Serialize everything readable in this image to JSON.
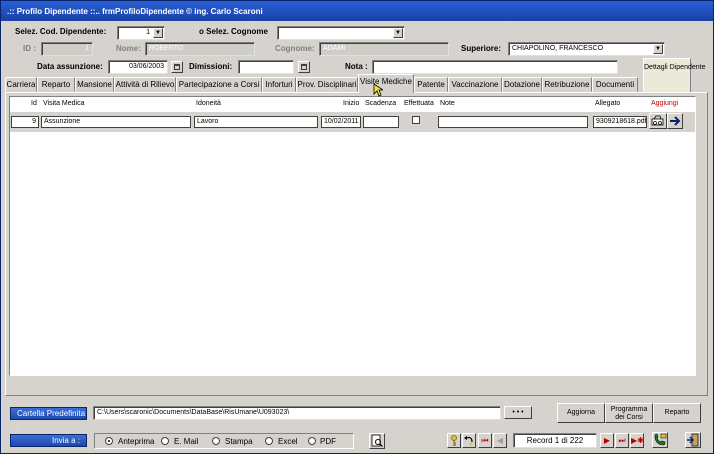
{
  "window": {
    "title": ".:: Profilo Dipendente ::..      frmProfiloDipendente © ing. Carlo Scaroni"
  },
  "header": {
    "sel_cod_label": "Selez. Cod. Dipendente:",
    "sel_cod_value": "1",
    "sel_cognome_label": "o Selez. Cognome",
    "sel_cognome_value": "",
    "id_label": "ID :",
    "id_value": "1",
    "nome_label": "Nome:",
    "nome_value": "ROBERTO",
    "cognome_label": "Cognome:",
    "cognome_value": "ADAMI",
    "superiore_label": "Superiore:",
    "superiore_value": "CHIAPOLINO, FRANCESCO",
    "data_assunzione_label": "Data assunzione:",
    "data_assunzione_value": "03/06/2003",
    "dimissioni_label": "Dimissioni:",
    "dimissioni_value": "",
    "nota_label": "Nota :",
    "nota_value": "",
    "dettagli_label": "Dettagli Dipendente"
  },
  "tabs": [
    {
      "label": "Carriera"
    },
    {
      "label": "Reparto"
    },
    {
      "label": "Mansione"
    },
    {
      "label": "Attività di Rilievo"
    },
    {
      "label": "Partecipazione a Corsi"
    },
    {
      "label": "Inforturi"
    },
    {
      "label": "Prov. Disciplinari"
    },
    {
      "label": "Visite Mediche"
    },
    {
      "label": "Patente"
    },
    {
      "label": "Vaccinazione"
    },
    {
      "label": "Dotazione"
    },
    {
      "label": "Retribuzione"
    },
    {
      "label": "Documenti"
    }
  ],
  "active_tab": "Visite Mediche",
  "grid": {
    "headers": {
      "id": "Id",
      "visita": "Visita Medica",
      "idoneita": "Idoneità",
      "inizio": "Inizio",
      "scadenza": "Scadenza",
      "effettuata": "Effettuata",
      "note": "Note",
      "allegato": "Allegato",
      "aggiungi": "Aggiungi"
    },
    "rows": [
      {
        "id": "9",
        "visita": "Assunzione",
        "idoneita": "Lavoro",
        "inizio": "10/02/2011",
        "scadenza": "",
        "effettuata": false,
        "note": "",
        "allegato": "9309218618.pdf"
      }
    ]
  },
  "footer": {
    "cartella_label": "Cartella Predefinita :",
    "cartella_value": "C:\\Users\\scaronic\\Documents\\DataBase\\RisUmane\\U093023\\",
    "browse_label": "• • •",
    "aggiorna_label": "Aggiorna",
    "programma_label": "Programma dei Corsi",
    "reparto_label": "Reparto",
    "invia_label": "Invia a :",
    "options": [
      "Anteprima",
      "E. Mail",
      "Stampa",
      "Excel",
      "PDF"
    ],
    "selected_option": "Anteprima",
    "record_label": "Record 1 di 222"
  },
  "colors": {
    "title_bar": "#1941a5",
    "accent_red": "#c00000",
    "label_blue": "#1c49b0"
  }
}
